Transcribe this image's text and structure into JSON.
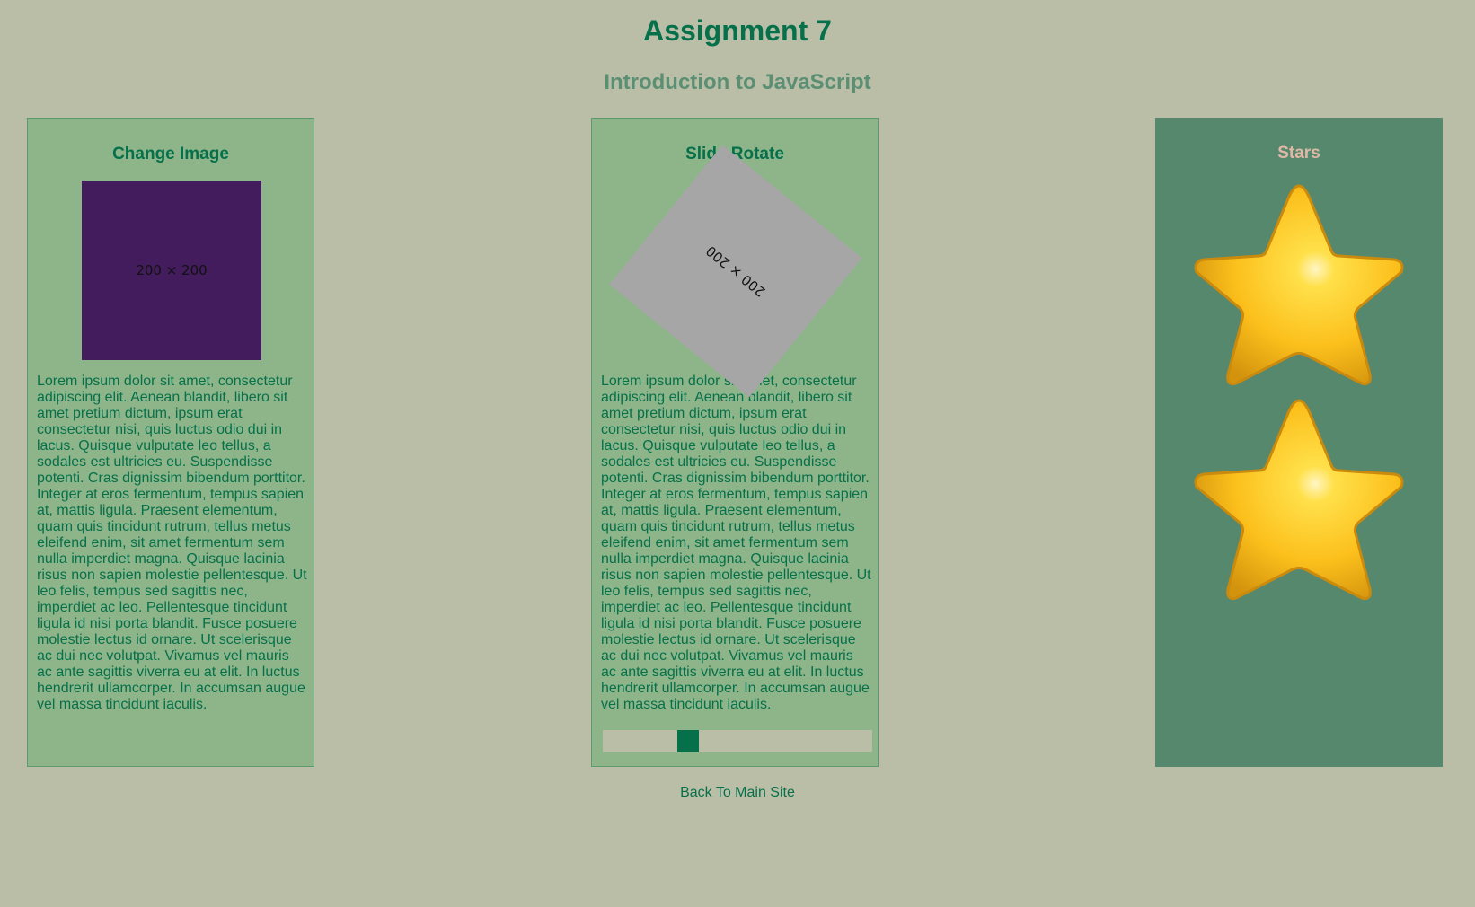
{
  "header": {
    "title": "Assignment 7",
    "subtitle": "Introduction to JavaScript"
  },
  "panels": {
    "change_image": {
      "title": "Change Image",
      "image_label": "200 × 200",
      "image_color": "#431c5d",
      "text": "Lorem ipsum dolor sit amet, consectetur adipiscing elit. Aenean blandit, libero sit amet pretium dictum, ipsum erat consectetur nisi, quis luctus odio dui in lacus. Quisque vulputate leo tellus, a sodales est ultricies eu. Suspendisse potenti. Cras dignissim bibendum porttitor. Integer at eros fermentum, tempus sapien at, mattis ligula. Praesent elementum, quam quis tincidunt rutrum, tellus metus eleifend enim, sit amet fermentum sem nulla imperdiet magna. Quisque lacinia risus non sapien molestie pellentesque. Ut leo felis, tempus sed sagittis nec, imperdiet ac leo. Pellentesque tincidunt ligula id nisi porta blandit. Fusce posuere molestie lectus id ornare. Ut scelerisque ac dui nec volutpat. Vivamus vel mauris ac ante sagittis viverra eu at elit. In luctus hendrerit ullamcorper. In accumsan augue vel massa tincidunt iaculis."
    },
    "slide_rotate": {
      "title": "Slide Rotate",
      "image_label": "200 × 200",
      "rotation_degrees": 219,
      "slider_value_fraction": 0.3,
      "text": "Lorem ipsum dolor sit amet, consectetur adipiscing elit. Aenean blandit, libero sit amet pretium dictum, ipsum erat consectetur nisi, quis luctus odio dui in lacus. Quisque vulputate leo tellus, a sodales est ultricies eu. Suspendisse potenti. Cras dignissim bibendum porttitor. Integer at eros fermentum, tempus sapien at, mattis ligula. Praesent elementum, quam quis tincidunt rutrum, tellus metus eleifend enim, sit amet fermentum sem nulla imperdiet magna. Quisque lacinia risus non sapien molestie pellentesque. Ut leo felis, tempus sed sagittis nec, imperdiet ac leo. Pellentesque tincidunt ligula id nisi porta blandit. Fusce posuere molestie lectus id ornare. Ut scelerisque ac dui nec volutpat. Vivamus vel mauris ac ante sagittis viverra eu at elit. In luctus hendrerit ullamcorper. In accumsan augue vel massa tincidunt iaculis."
    },
    "stars": {
      "title": "Stars",
      "star_count": 2,
      "star_icon": "star-icon"
    }
  },
  "footer": {
    "back_link": "Back To Main Site"
  },
  "colors": {
    "page_bg": "#bbbea7",
    "panel_bg": "#8eb58a",
    "stars_panel_bg": "#56886d",
    "accent": "#06704a",
    "subtitle": "#5a8f73",
    "stars_title": "#e0b8a6",
    "star_fill": "#fcc01c"
  }
}
